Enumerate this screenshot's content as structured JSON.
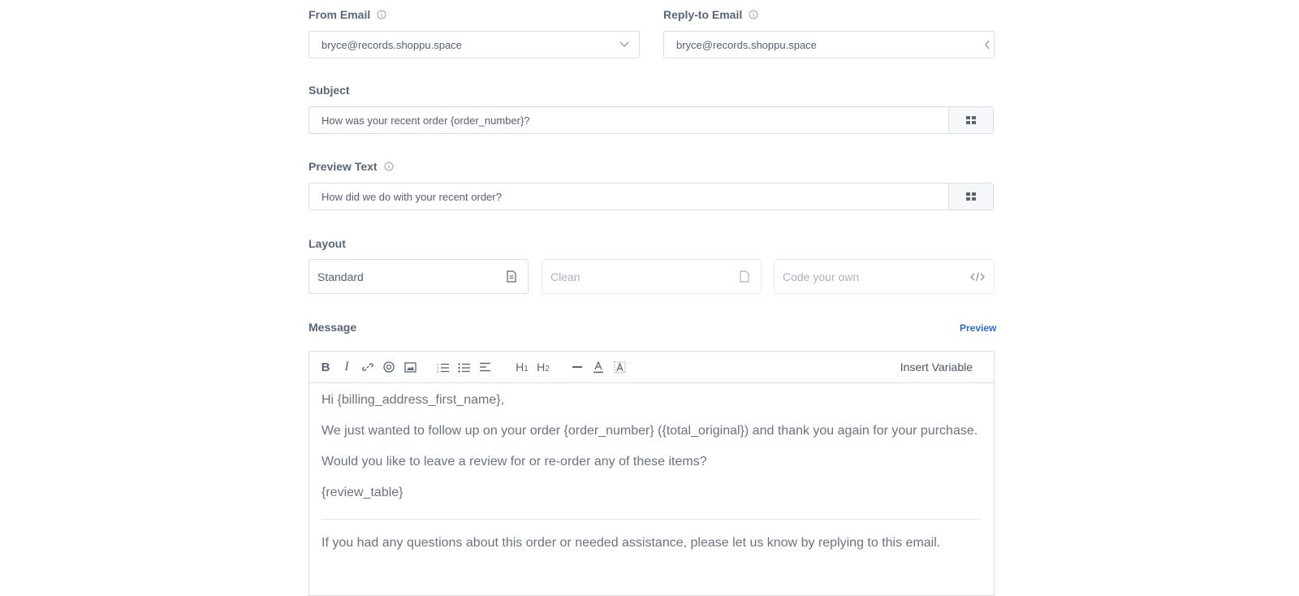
{
  "from_email": {
    "label": "From Email",
    "value": "bryce@records.shoppu.space"
  },
  "reply_to": {
    "label": "Reply-to Email",
    "value": "bryce@records.shoppu.space"
  },
  "subject": {
    "label": "Subject",
    "value": "How was your recent order {order_number}?"
  },
  "preview_text": {
    "label": "Preview Text",
    "value": "How did we do with your recent order?"
  },
  "layout": {
    "label": "Layout",
    "options": [
      {
        "label": "Standard",
        "icon": "document-icon",
        "selected": true
      },
      {
        "label": "Clean",
        "icon": "blank-page-icon",
        "selected": false
      },
      {
        "label": "Code your own",
        "icon": "code-icon",
        "selected": false
      }
    ]
  },
  "message": {
    "label": "Message",
    "preview_link": "Preview",
    "insert_variable": "Insert Variable",
    "toolbar": [
      "bold-icon",
      "italic-icon",
      "link-icon",
      "target-icon",
      "image-icon",
      "ordered-list-icon",
      "bullet-list-icon",
      "align-left-icon",
      "heading1-icon",
      "heading2-icon",
      "horizontal-rule-icon",
      "text-color-icon",
      "highlight-icon"
    ],
    "body": {
      "greeting": "Hi {billing_address_first_name},",
      "line1": "We just wanted to follow up on your order {order_number} ({total_original}) and thank you again for your purchase.",
      "line2": "Would you like to leave a review for or re-order any of these items?",
      "line3": "{review_table}",
      "line4": "If you had any questions about this order or needed assistance, please let us know by replying to this email."
    }
  },
  "colors": {
    "accent": "#2b6cd6",
    "border": "#d9dee4",
    "label": "#5a6677"
  }
}
